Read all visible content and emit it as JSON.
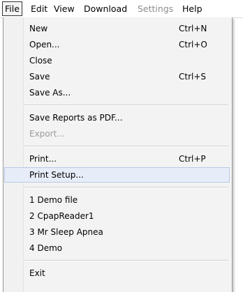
{
  "menubar": {
    "items": [
      {
        "label": "File"
      },
      {
        "label": "Edit"
      },
      {
        "label": "View"
      },
      {
        "label": "Download"
      },
      {
        "label": "Settings"
      },
      {
        "label": "Help"
      }
    ]
  },
  "file_menu": {
    "items": [
      {
        "label": "New",
        "shortcut": "Ctrl+N"
      },
      {
        "label": "Open...",
        "shortcut": "Ctrl+O"
      },
      {
        "label": "Close",
        "shortcut": ""
      },
      {
        "label": "Save",
        "shortcut": "Ctrl+S"
      },
      {
        "label": "Save As...",
        "shortcut": ""
      },
      {
        "label": "Save Reports as PDF...",
        "shortcut": ""
      },
      {
        "label": "Export...",
        "shortcut": ""
      },
      {
        "label": "Print...",
        "shortcut": "Ctrl+P"
      },
      {
        "label": "Print Setup...",
        "shortcut": ""
      },
      {
        "label": "1 Demo file",
        "shortcut": ""
      },
      {
        "label": "2 CpapReader1",
        "shortcut": ""
      },
      {
        "label": "3 Mr Sleep Apnea",
        "shortcut": ""
      },
      {
        "label": "4 Demo",
        "shortcut": ""
      },
      {
        "label": "Exit",
        "shortcut": ""
      }
    ]
  },
  "colors": {
    "highlight_bg": "#e6edf8",
    "highlight_border": "#b6c9e6",
    "disabled_text": "#9b9b9b"
  }
}
